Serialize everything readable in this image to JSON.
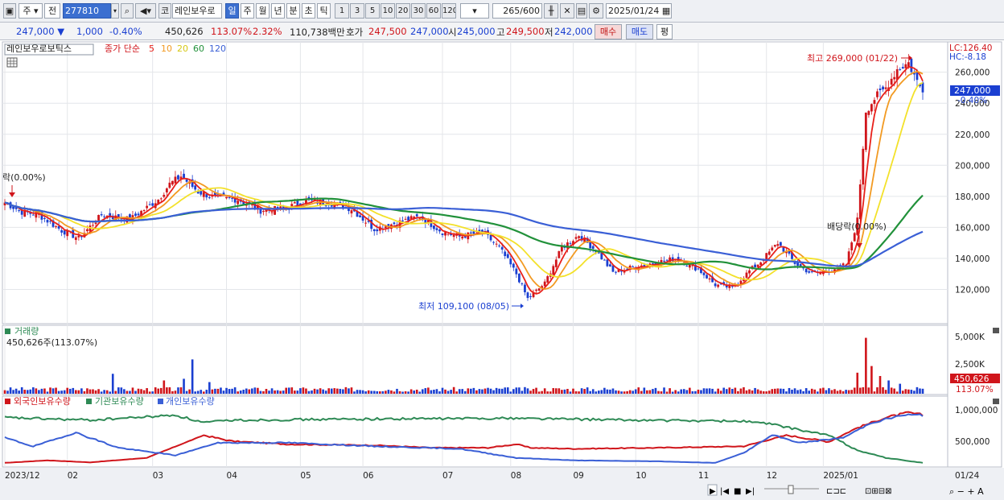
{
  "toolbar": {
    "market": "주",
    "prev": "전",
    "code": "277810",
    "type_btn": "코",
    "stock_name": "레인보우로",
    "periods": [
      "일",
      "주",
      "월",
      "년",
      "분",
      "초",
      "틱"
    ],
    "selected_period": "일",
    "intervals": [
      "1",
      "3",
      "5",
      "10",
      "20",
      "30",
      "60",
      "120"
    ],
    "count": "265",
    "count_total": "/600",
    "date": "2025/01/24"
  },
  "quote": {
    "price": "247,000",
    "change": "1,000",
    "change_pct": "-0.40%",
    "volume": "450,626",
    "volume_pct": "113.07%",
    "turnover_pct": "2.32%",
    "amount": "110,738백만",
    "bid_label": "호가",
    "bid": "247,500",
    "ask": "247,000",
    "open_label": "시",
    "open": "245,000",
    "high_label": "고",
    "high": "249,500",
    "low_label": "저",
    "low": "242,000",
    "buy": "매수",
    "sell": "매도",
    "eval": "평"
  },
  "colors": {
    "up": "#d0151b",
    "down": "#1a3fd1",
    "ma5": "#e8201a",
    "ma10": "#f29a22",
    "ma20": "#f3e12a",
    "ma60": "#21913a",
    "ma120": "#3a5fd6",
    "green": "#2e8a55"
  },
  "chart_data": [
    {
      "type": "candlestick",
      "title": "레인보우로보틱스",
      "legend": [
        "종가 단순",
        "5",
        "10",
        "20",
        "60",
        "120"
      ],
      "x_ticks": [
        "2023/12",
        "02",
        "03",
        "04",
        "05",
        "06",
        "07",
        "08",
        "09",
        "10",
        "11",
        "12",
        "2025/01",
        "01/24"
      ],
      "y_ticks": [
        120000,
        140000,
        160000,
        180000,
        200000,
        220000,
        240000,
        260000
      ],
      "ylim": [
        100000,
        278000
      ],
      "lc": "LC:126.40",
      "hc": "HC:-8.18",
      "last_price_label": "247,000",
      "last_pct_label": "-0.40%",
      "annotations": {
        "high": "최고 269,000 (01/22)",
        "low": "최저 109,100 (08/05)",
        "dividend": "배당락(0.00%)",
        "dividend_left": "락(0.00%)"
      },
      "close_anchors": [
        [
          0,
          176000
        ],
        [
          6,
          170000
        ],
        [
          12,
          168000
        ],
        [
          20,
          158000
        ],
        [
          26,
          153000
        ],
        [
          34,
          168000
        ],
        [
          44,
          165000
        ],
        [
          54,
          178000
        ],
        [
          58,
          188000
        ],
        [
          62,
          193000
        ],
        [
          68,
          183000
        ],
        [
          74,
          179000
        ],
        [
          82,
          178000
        ],
        [
          90,
          171000
        ],
        [
          98,
          172000
        ],
        [
          106,
          177000
        ],
        [
          114,
          176000
        ],
        [
          122,
          172000
        ],
        [
          130,
          159000
        ],
        [
          138,
          163000
        ],
        [
          146,
          167000
        ],
        [
          154,
          157000
        ],
        [
          160,
          154000
        ],
        [
          168,
          157000
        ],
        [
          174,
          147000
        ],
        [
          180,
          130000
        ],
        [
          184,
          114000
        ],
        [
          190,
          124000
        ],
        [
          196,
          147000
        ],
        [
          202,
          155000
        ],
        [
          208,
          145000
        ],
        [
          214,
          131000
        ],
        [
          220,
          134000
        ],
        [
          228,
          137000
        ],
        [
          236,
          140000
        ],
        [
          244,
          133000
        ],
        [
          250,
          123000
        ],
        [
          256,
          121000
        ],
        [
          262,
          132000
        ],
        [
          266,
          138000
        ],
        [
          272,
          150000
        ],
        [
          278,
          137000
        ],
        [
          284,
          130000
        ],
        [
          290,
          132000
        ],
        [
          296,
          136000
        ],
        [
          300,
          165000
        ],
        [
          303,
          235000
        ],
        [
          306,
          243000
        ],
        [
          310,
          250000
        ],
        [
          314,
          262000
        ],
        [
          318,
          266000
        ],
        [
          321,
          254000
        ],
        [
          323,
          248000
        ]
      ],
      "ma_periods": [
        5,
        10,
        20,
        60,
        120
      ],
      "x_count": 324
    },
    {
      "type": "bar",
      "title": "거래량",
      "value_label": "450,626주(113.07%)",
      "y_ticks": [
        "2,500K",
        "5,000K"
      ],
      "last_label": "450,626",
      "last_pct": "113.07%",
      "spikes": [
        [
          38,
          1800
        ],
        [
          56,
          1200
        ],
        [
          63,
          1350
        ],
        [
          66,
          3100
        ],
        [
          72,
          1050
        ],
        [
          300,
          1900
        ],
        [
          303,
          5050
        ],
        [
          305,
          2500
        ],
        [
          308,
          1600
        ],
        [
          311,
          1200
        ],
        [
          315,
          900
        ]
      ],
      "ylim": [
        0,
        5600
      ]
    },
    {
      "type": "line",
      "title_series": [
        "외국인보유수량",
        "기관보유수량",
        "개인보유수량"
      ],
      "y_ticks": [
        "500,000",
        "1,000,000"
      ],
      "ylim": [
        0,
        1250000
      ],
      "series": [
        {
          "name": "외국인보유수량",
          "anchors": [
            [
              0,
              50000
            ],
            [
              15,
              100000
            ],
            [
              30,
              60000
            ],
            [
              50,
              150000
            ],
            [
              70,
              600000
            ],
            [
              80,
              480000
            ],
            [
              100,
              420000
            ],
            [
              130,
              400000
            ],
            [
              150,
              350000
            ],
            [
              170,
              350000
            ],
            [
              180,
              420000
            ],
            [
              185,
              350000
            ],
            [
              200,
              330000
            ],
            [
              230,
              350000
            ],
            [
              260,
              380000
            ],
            [
              275,
              600000
            ],
            [
              290,
              470000
            ],
            [
              300,
              750000
            ],
            [
              310,
              950000
            ],
            [
              318,
              1050000
            ],
            [
              323,
              1000000
            ]
          ]
        },
        {
          "name": "기관보유수량",
          "anchors": [
            [
              0,
              950000
            ],
            [
              30,
              900000
            ],
            [
              60,
              1000000
            ],
            [
              70,
              850000
            ],
            [
              80,
              900000
            ],
            [
              120,
              920000
            ],
            [
              180,
              940000
            ],
            [
              220,
              900000
            ],
            [
              260,
              880000
            ],
            [
              270,
              820000
            ],
            [
              280,
              700000
            ],
            [
              290,
              600000
            ],
            [
              300,
              300000
            ],
            [
              310,
              150000
            ],
            [
              323,
              50000
            ]
          ]
        },
        {
          "name": "개인보유수량",
          "anchors": [
            [
              0,
              550000
            ],
            [
              10,
              380000
            ],
            [
              25,
              650000
            ],
            [
              40,
              350000
            ],
            [
              60,
              200000
            ],
            [
              75,
              450000
            ],
            [
              100,
              450000
            ],
            [
              130,
              380000
            ],
            [
              160,
              330000
            ],
            [
              180,
              150000
            ],
            [
              200,
              100000
            ],
            [
              230,
              80000
            ],
            [
              250,
              50000
            ],
            [
              260,
              250000
            ],
            [
              270,
              600000
            ],
            [
              280,
              450000
            ],
            [
              295,
              550000
            ],
            [
              305,
              850000
            ],
            [
              316,
              1000000
            ],
            [
              323,
              1000000
            ]
          ]
        }
      ]
    }
  ]
}
